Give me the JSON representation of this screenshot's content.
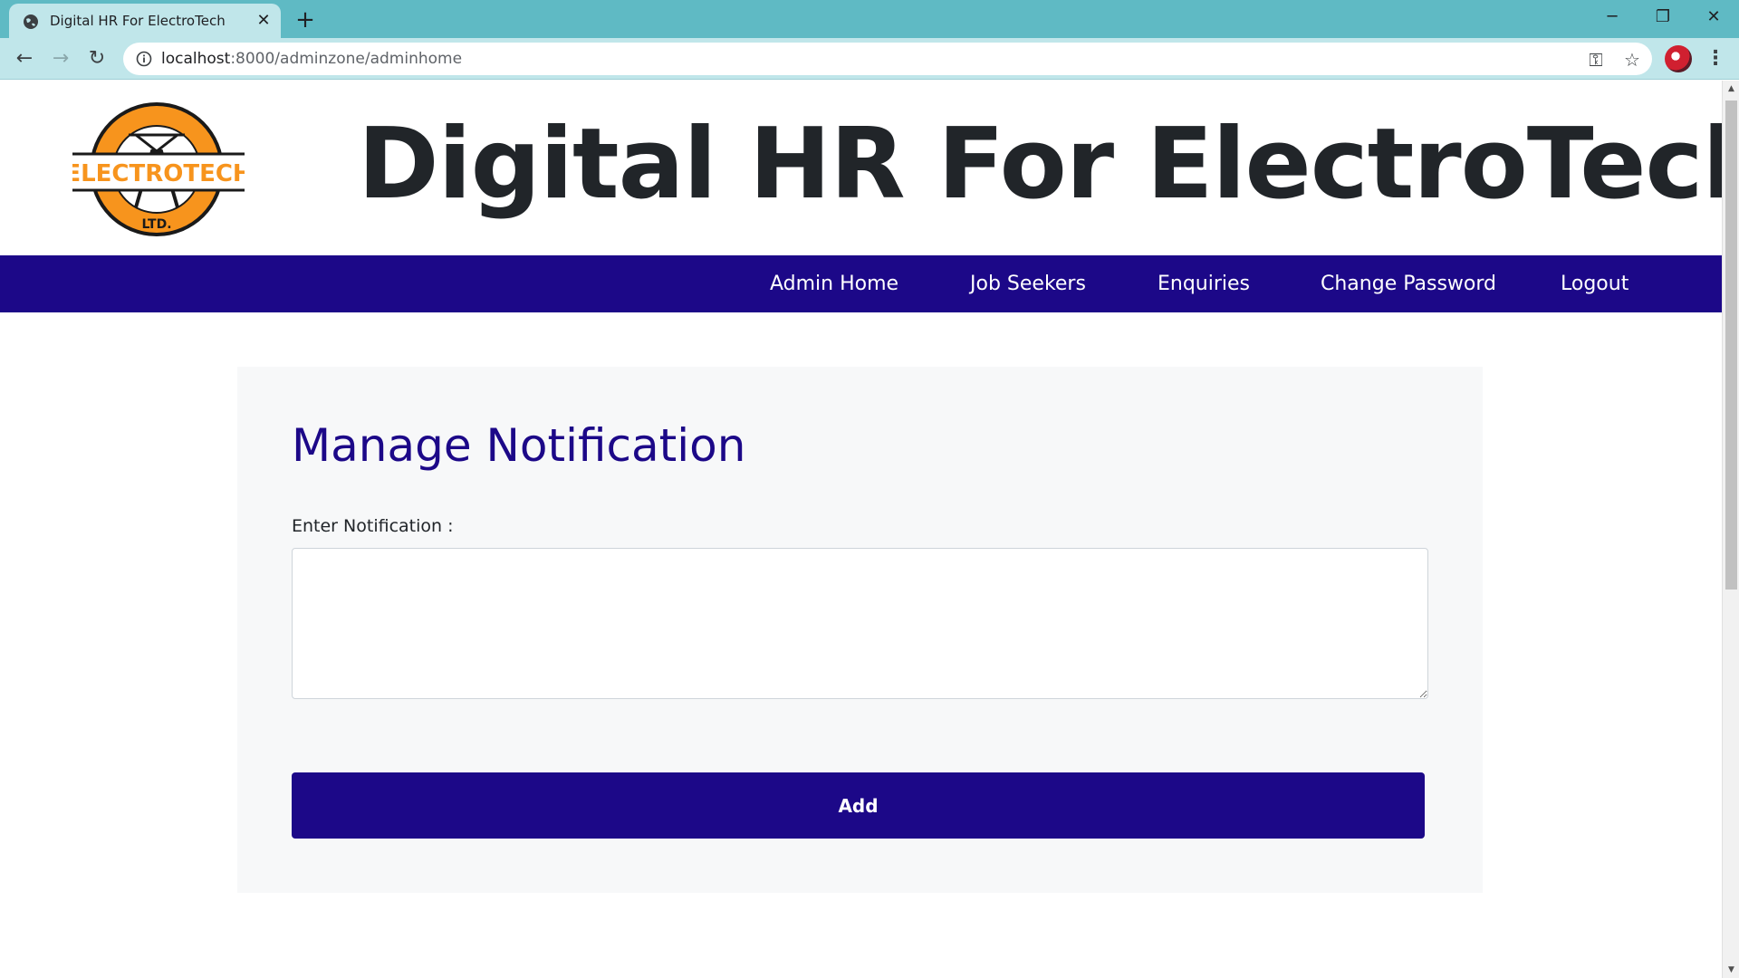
{
  "browser": {
    "tab_title": "Digital HR For ElectroTech",
    "new_tab_icon": "plus-icon",
    "url_host": "localhost",
    "url_rest": ":8000/adminzone/adminhome",
    "window_controls": [
      "minimize",
      "restore",
      "close"
    ]
  },
  "site": {
    "logo_text_main": "ELECTROTECH",
    "logo_text_sub": "LTD.",
    "title": "Digital HR For ElectroTech",
    "colors": {
      "brand": "#1c0888",
      "logo_orange": "#f7941d",
      "title_text": "#212529"
    }
  },
  "nav": {
    "items": [
      {
        "label": "Admin Home"
      },
      {
        "label": "Job Seekers"
      },
      {
        "label": "Enquiries"
      },
      {
        "label": "Change Password"
      },
      {
        "label": "Logout"
      }
    ]
  },
  "form": {
    "heading": "Manage Notification",
    "notification_label": "Enter Notification :",
    "notification_value": "",
    "submit_label": "Add"
  }
}
